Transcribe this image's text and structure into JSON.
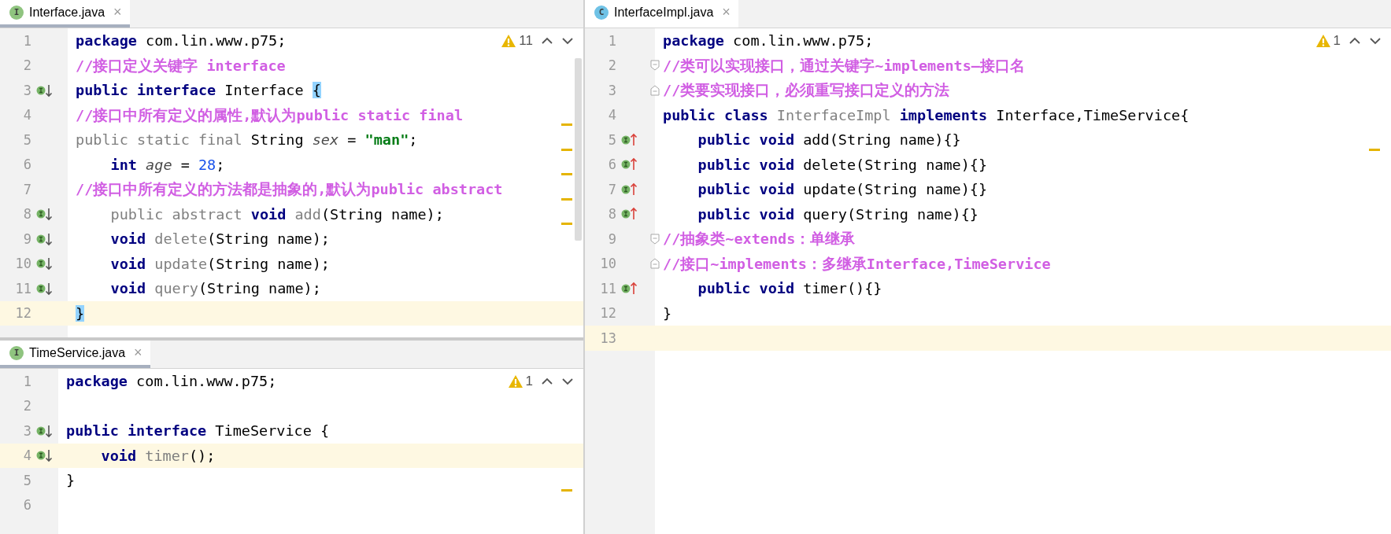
{
  "editors": [
    {
      "tab": {
        "kind": "interface",
        "icon_letter": "I",
        "label": "Interface.java",
        "close": "×",
        "selected": true
      },
      "warnings": "11",
      "scrollbar": true,
      "lines": [
        {
          "number": "1",
          "current": false,
          "stripe": false,
          "indent": false,
          "tokens": [
            {
              "kind": "kw",
              "text": "package"
            },
            {
              "kind": "id",
              "text": " com.lin.www.p75;"
            }
          ]
        },
        {
          "number": "2",
          "current": false,
          "stripe": false,
          "indent": false,
          "tokens": [
            {
              "kind": "cm",
              "text": "//接口定义关键字 interface"
            }
          ]
        },
        {
          "number": "3",
          "kind": "implemented",
          "current": false,
          "stripe": false,
          "indent": false,
          "tokens": [
            {
              "kind": "kw",
              "text": "public interface"
            },
            {
              "kind": "id",
              "text": " Interface "
            },
            {
              "kind": "brace",
              "text": "{"
            }
          ]
        },
        {
          "number": "4",
          "current": false,
          "stripe": true,
          "indent": false,
          "tokens": [
            {
              "kind": "cm",
              "text": "//接口中所有定义的属性,默认为public static final"
            }
          ]
        },
        {
          "number": "5",
          "current": false,
          "stripe": true,
          "indent": false,
          "tokens": [
            {
              "kind": "redundant",
              "text": "public static final"
            },
            {
              "kind": "id",
              "text": " String "
            },
            {
              "kind": "fld",
              "text": "sex"
            },
            {
              "kind": "id",
              "text": " = "
            },
            {
              "kind": "str",
              "text": "\"man\""
            },
            {
              "kind": "id",
              "text": ";"
            }
          ]
        },
        {
          "number": "6",
          "current": false,
          "stripe": true,
          "indent": true,
          "tokens": [
            {
              "kind": "kw",
              "text": "int"
            },
            {
              "kind": "fld",
              "text": " age"
            },
            {
              "kind": "id",
              "text": " = "
            },
            {
              "kind": "num",
              "text": "28"
            },
            {
              "kind": "id",
              "text": ";"
            }
          ]
        },
        {
          "number": "7",
          "current": false,
          "stripe": true,
          "indent": false,
          "tokens": [
            {
              "kind": "cm",
              "text": "//接口中所有定义的方法都是抽象的,默认为public abstract"
            }
          ]
        },
        {
          "number": "8",
          "kind": "implemented",
          "current": false,
          "stripe": true,
          "indent": true,
          "tokens": [
            {
              "kind": "redundant",
              "text": "public abstract "
            },
            {
              "kind": "kw",
              "text": "void"
            },
            {
              "kind": "unused",
              "text": " add"
            },
            {
              "kind": "id",
              "text": "(String name);"
            }
          ]
        },
        {
          "number": "9",
          "kind": "implemented",
          "current": false,
          "stripe": false,
          "indent": true,
          "tokens": [
            {
              "kind": "kw",
              "text": "void"
            },
            {
              "kind": "unused",
              "text": " delete"
            },
            {
              "kind": "id",
              "text": "(String name);"
            }
          ]
        },
        {
          "number": "10",
          "kind": "implemented",
          "current": false,
          "stripe": false,
          "indent": true,
          "tokens": [
            {
              "kind": "kw",
              "text": "void"
            },
            {
              "kind": "unused",
              "text": " update"
            },
            {
              "kind": "id",
              "text": "(String name);"
            }
          ]
        },
        {
          "number": "11",
          "kind": "implemented",
          "current": false,
          "stripe": false,
          "indent": true,
          "tokens": [
            {
              "kind": "kw",
              "text": "void"
            },
            {
              "kind": "unused",
              "text": " query"
            },
            {
              "kind": "id",
              "text": "(String name);"
            }
          ]
        },
        {
          "number": "12",
          "current": true,
          "stripe": false,
          "indent": false,
          "tokens": [
            {
              "kind": "brace",
              "text": "}"
            }
          ]
        }
      ]
    },
    {
      "tab": {
        "kind": "interface",
        "icon_letter": "I",
        "label": "TimeService.java",
        "close": "×",
        "selected": true
      },
      "warnings": "1",
      "scrollbar": false,
      "lines": [
        {
          "number": "1",
          "current": false,
          "stripe": false,
          "indent": false,
          "tokens": [
            {
              "kind": "kw",
              "text": "package"
            },
            {
              "kind": "id",
              "text": " com.lin.www.p75;"
            }
          ]
        },
        {
          "number": "2",
          "current": false,
          "stripe": false
        },
        {
          "number": "3",
          "kind": "implemented",
          "current": false,
          "stripe": false,
          "indent": false,
          "tokens": [
            {
              "kind": "kw",
              "text": "public interface"
            },
            {
              "kind": "id",
              "text": " TimeService {"
            }
          ]
        },
        {
          "number": "4",
          "kind": "implemented",
          "current": true,
          "stripe": false,
          "indent": true,
          "tokens": [
            {
              "kind": "kw",
              "text": "void"
            },
            {
              "kind": "unused",
              "text": " timer"
            },
            {
              "kind": "id",
              "text": "();"
            }
          ]
        },
        {
          "number": "5",
          "current": false,
          "stripe": true,
          "indent": false,
          "tokens": [
            {
              "kind": "id",
              "text": "}"
            }
          ]
        },
        {
          "number": "6",
          "current": false,
          "stripe": false
        }
      ]
    },
    {
      "tab": {
        "kind": "class",
        "icon_letter": "C",
        "label": "InterfaceImpl.java",
        "close": "×",
        "selected": false
      },
      "warnings": "1",
      "scrollbar": false,
      "lines": [
        {
          "number": "1",
          "current": false,
          "stripe": false,
          "indent": false,
          "tokens": [
            {
              "kind": "kw",
              "text": "package"
            },
            {
              "kind": "id",
              "text": " com.lin.www.p75;"
            }
          ]
        },
        {
          "number": "2",
          "kind": "fold_start",
          "current": false,
          "stripe": false,
          "indent": false,
          "tokens": [
            {
              "kind": "cm",
              "text": "//类可以实现接口，通过关键字~implements—接口名"
            }
          ]
        },
        {
          "number": "3",
          "kind": "fold_end",
          "current": false,
          "stripe": false,
          "indent": false,
          "tokens": [
            {
              "kind": "cm",
              "text": "//类要实现接口，必须重写接口定义的方法"
            }
          ]
        },
        {
          "number": "4",
          "current": false,
          "stripe": false,
          "indent": false,
          "tokens": [
            {
              "kind": "kw",
              "text": "public class"
            },
            {
              "kind": "unused",
              "text": " InterfaceImpl "
            },
            {
              "kind": "kw",
              "text": "implements"
            },
            {
              "kind": "id",
              "text": " Interface,TimeService{"
            }
          ]
        },
        {
          "number": "5",
          "kind": "implements",
          "current": false,
          "stripe": true,
          "indent": true,
          "tokens": [
            {
              "kind": "kw",
              "text": "public void"
            },
            {
              "kind": "id",
              "text": " add(String name){}"
            }
          ]
        },
        {
          "number": "6",
          "kind": "implements",
          "current": false,
          "stripe": false,
          "indent": true,
          "tokens": [
            {
              "kind": "kw",
              "text": "public void"
            },
            {
              "kind": "id",
              "text": " delete(String name){}"
            }
          ]
        },
        {
          "number": "7",
          "kind": "implements",
          "current": false,
          "stripe": false,
          "indent": true,
          "tokens": [
            {
              "kind": "kw",
              "text": "public void"
            },
            {
              "kind": "id",
              "text": " update(String name){}"
            }
          ]
        },
        {
          "number": "8",
          "kind": "implements",
          "current": false,
          "stripe": false,
          "indent": true,
          "tokens": [
            {
              "kind": "kw",
              "text": "public void"
            },
            {
              "kind": "id",
              "text": " query(String name){}"
            }
          ]
        },
        {
          "number": "9",
          "kind": "fold_start",
          "current": false,
          "stripe": false,
          "indent": false,
          "tokens": [
            {
              "kind": "cm",
              "text": "//抽象类~extends：单继承"
            }
          ]
        },
        {
          "number": "10",
          "kind": "fold_end",
          "current": false,
          "stripe": false,
          "indent": false,
          "tokens": [
            {
              "kind": "cm",
              "text": "//接口~implements：多继承Interface,TimeService"
            }
          ]
        },
        {
          "number": "11",
          "kind": "implements",
          "current": false,
          "stripe": false,
          "indent": true,
          "tokens": [
            {
              "kind": "kw",
              "text": "public void"
            },
            {
              "kind": "id",
              "text": " timer(){}"
            }
          ]
        },
        {
          "number": "12",
          "current": false,
          "stripe": false,
          "indent": false,
          "tokens": [
            {
              "kind": "id",
              "text": "}"
            }
          ]
        },
        {
          "number": "13",
          "current": true,
          "stripe": false
        }
      ]
    }
  ]
}
